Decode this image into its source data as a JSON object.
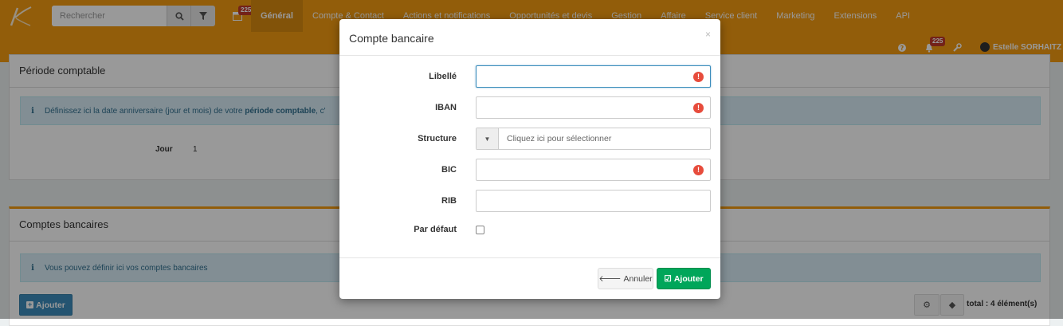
{
  "header": {
    "search_placeholder": "Rechercher",
    "notification_count": "225",
    "calendar_count": "225",
    "nav": [
      "Général",
      "Compte & Contact",
      "Actions et notifications",
      "Opportunités et devis",
      "Gestion",
      "Affaire",
      "Service client",
      "Marketing",
      "Extensions",
      "API"
    ],
    "user_name": "Estelle SORHAITZ"
  },
  "periode": {
    "title": "Période comptable",
    "info_prefix": "Définissez ici la date anniversaire (jour et mois) de votre ",
    "info_bold": "période comptable",
    "info_suffix": ", c'",
    "day_label": "Jour",
    "day_value": "1"
  },
  "comptes": {
    "title": "Comptes bancaires",
    "info": "Vous pouvez définir ici vos comptes bancaires",
    "add_button": "Ajouter",
    "total": "total : 4 élément(s)"
  },
  "modal": {
    "title": "Compte bancaire",
    "close": "×",
    "fields": {
      "libelle": "Libellé",
      "iban": "IBAN",
      "structure": "Structure",
      "structure_placeholder": "Cliquez ici pour sélectionner",
      "bic": "BIC",
      "rib": "RIB",
      "default": "Par défaut"
    },
    "cancel_button": "Annuler",
    "add_button": "Ajouter"
  },
  "colors": {
    "topbar": "#f39c12",
    "primary": "#3c8dbc",
    "success": "#00a65a",
    "error": "#e74c3c"
  }
}
